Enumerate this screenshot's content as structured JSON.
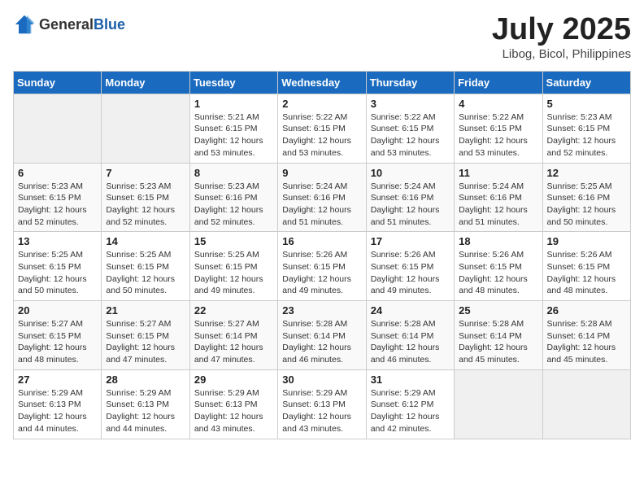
{
  "logo": {
    "text_general": "General",
    "text_blue": "Blue"
  },
  "calendar": {
    "title": "July 2025",
    "subtitle": "Libog, Bicol, Philippines"
  },
  "headers": [
    "Sunday",
    "Monday",
    "Tuesday",
    "Wednesday",
    "Thursday",
    "Friday",
    "Saturday"
  ],
  "weeks": [
    [
      {
        "day": "",
        "sunrise": "",
        "sunset": "",
        "daylight": ""
      },
      {
        "day": "",
        "sunrise": "",
        "sunset": "",
        "daylight": ""
      },
      {
        "day": "1",
        "sunrise": "Sunrise: 5:21 AM",
        "sunset": "Sunset: 6:15 PM",
        "daylight": "Daylight: 12 hours and 53 minutes."
      },
      {
        "day": "2",
        "sunrise": "Sunrise: 5:22 AM",
        "sunset": "Sunset: 6:15 PM",
        "daylight": "Daylight: 12 hours and 53 minutes."
      },
      {
        "day": "3",
        "sunrise": "Sunrise: 5:22 AM",
        "sunset": "Sunset: 6:15 PM",
        "daylight": "Daylight: 12 hours and 53 minutes."
      },
      {
        "day": "4",
        "sunrise": "Sunrise: 5:22 AM",
        "sunset": "Sunset: 6:15 PM",
        "daylight": "Daylight: 12 hours and 53 minutes."
      },
      {
        "day": "5",
        "sunrise": "Sunrise: 5:23 AM",
        "sunset": "Sunset: 6:15 PM",
        "daylight": "Daylight: 12 hours and 52 minutes."
      }
    ],
    [
      {
        "day": "6",
        "sunrise": "Sunrise: 5:23 AM",
        "sunset": "Sunset: 6:15 PM",
        "daylight": "Daylight: 12 hours and 52 minutes."
      },
      {
        "day": "7",
        "sunrise": "Sunrise: 5:23 AM",
        "sunset": "Sunset: 6:15 PM",
        "daylight": "Daylight: 12 hours and 52 minutes."
      },
      {
        "day": "8",
        "sunrise": "Sunrise: 5:23 AM",
        "sunset": "Sunset: 6:16 PM",
        "daylight": "Daylight: 12 hours and 52 minutes."
      },
      {
        "day": "9",
        "sunrise": "Sunrise: 5:24 AM",
        "sunset": "Sunset: 6:16 PM",
        "daylight": "Daylight: 12 hours and 51 minutes."
      },
      {
        "day": "10",
        "sunrise": "Sunrise: 5:24 AM",
        "sunset": "Sunset: 6:16 PM",
        "daylight": "Daylight: 12 hours and 51 minutes."
      },
      {
        "day": "11",
        "sunrise": "Sunrise: 5:24 AM",
        "sunset": "Sunset: 6:16 PM",
        "daylight": "Daylight: 12 hours and 51 minutes."
      },
      {
        "day": "12",
        "sunrise": "Sunrise: 5:25 AM",
        "sunset": "Sunset: 6:16 PM",
        "daylight": "Daylight: 12 hours and 50 minutes."
      }
    ],
    [
      {
        "day": "13",
        "sunrise": "Sunrise: 5:25 AM",
        "sunset": "Sunset: 6:15 PM",
        "daylight": "Daylight: 12 hours and 50 minutes."
      },
      {
        "day": "14",
        "sunrise": "Sunrise: 5:25 AM",
        "sunset": "Sunset: 6:15 PM",
        "daylight": "Daylight: 12 hours and 50 minutes."
      },
      {
        "day": "15",
        "sunrise": "Sunrise: 5:25 AM",
        "sunset": "Sunset: 6:15 PM",
        "daylight": "Daylight: 12 hours and 49 minutes."
      },
      {
        "day": "16",
        "sunrise": "Sunrise: 5:26 AM",
        "sunset": "Sunset: 6:15 PM",
        "daylight": "Daylight: 12 hours and 49 minutes."
      },
      {
        "day": "17",
        "sunrise": "Sunrise: 5:26 AM",
        "sunset": "Sunset: 6:15 PM",
        "daylight": "Daylight: 12 hours and 49 minutes."
      },
      {
        "day": "18",
        "sunrise": "Sunrise: 5:26 AM",
        "sunset": "Sunset: 6:15 PM",
        "daylight": "Daylight: 12 hours and 48 minutes."
      },
      {
        "day": "19",
        "sunrise": "Sunrise: 5:26 AM",
        "sunset": "Sunset: 6:15 PM",
        "daylight": "Daylight: 12 hours and 48 minutes."
      }
    ],
    [
      {
        "day": "20",
        "sunrise": "Sunrise: 5:27 AM",
        "sunset": "Sunset: 6:15 PM",
        "daylight": "Daylight: 12 hours and 48 minutes."
      },
      {
        "day": "21",
        "sunrise": "Sunrise: 5:27 AM",
        "sunset": "Sunset: 6:15 PM",
        "daylight": "Daylight: 12 hours and 47 minutes."
      },
      {
        "day": "22",
        "sunrise": "Sunrise: 5:27 AM",
        "sunset": "Sunset: 6:14 PM",
        "daylight": "Daylight: 12 hours and 47 minutes."
      },
      {
        "day": "23",
        "sunrise": "Sunrise: 5:28 AM",
        "sunset": "Sunset: 6:14 PM",
        "daylight": "Daylight: 12 hours and 46 minutes."
      },
      {
        "day": "24",
        "sunrise": "Sunrise: 5:28 AM",
        "sunset": "Sunset: 6:14 PM",
        "daylight": "Daylight: 12 hours and 46 minutes."
      },
      {
        "day": "25",
        "sunrise": "Sunrise: 5:28 AM",
        "sunset": "Sunset: 6:14 PM",
        "daylight": "Daylight: 12 hours and 45 minutes."
      },
      {
        "day": "26",
        "sunrise": "Sunrise: 5:28 AM",
        "sunset": "Sunset: 6:14 PM",
        "daylight": "Daylight: 12 hours and 45 minutes."
      }
    ],
    [
      {
        "day": "27",
        "sunrise": "Sunrise: 5:29 AM",
        "sunset": "Sunset: 6:13 PM",
        "daylight": "Daylight: 12 hours and 44 minutes."
      },
      {
        "day": "28",
        "sunrise": "Sunrise: 5:29 AM",
        "sunset": "Sunset: 6:13 PM",
        "daylight": "Daylight: 12 hours and 44 minutes."
      },
      {
        "day": "29",
        "sunrise": "Sunrise: 5:29 AM",
        "sunset": "Sunset: 6:13 PM",
        "daylight": "Daylight: 12 hours and 43 minutes."
      },
      {
        "day": "30",
        "sunrise": "Sunrise: 5:29 AM",
        "sunset": "Sunset: 6:13 PM",
        "daylight": "Daylight: 12 hours and 43 minutes."
      },
      {
        "day": "31",
        "sunrise": "Sunrise: 5:29 AM",
        "sunset": "Sunset: 6:12 PM",
        "daylight": "Daylight: 12 hours and 42 minutes."
      },
      {
        "day": "",
        "sunrise": "",
        "sunset": "",
        "daylight": ""
      },
      {
        "day": "",
        "sunrise": "",
        "sunset": "",
        "daylight": ""
      }
    ]
  ]
}
